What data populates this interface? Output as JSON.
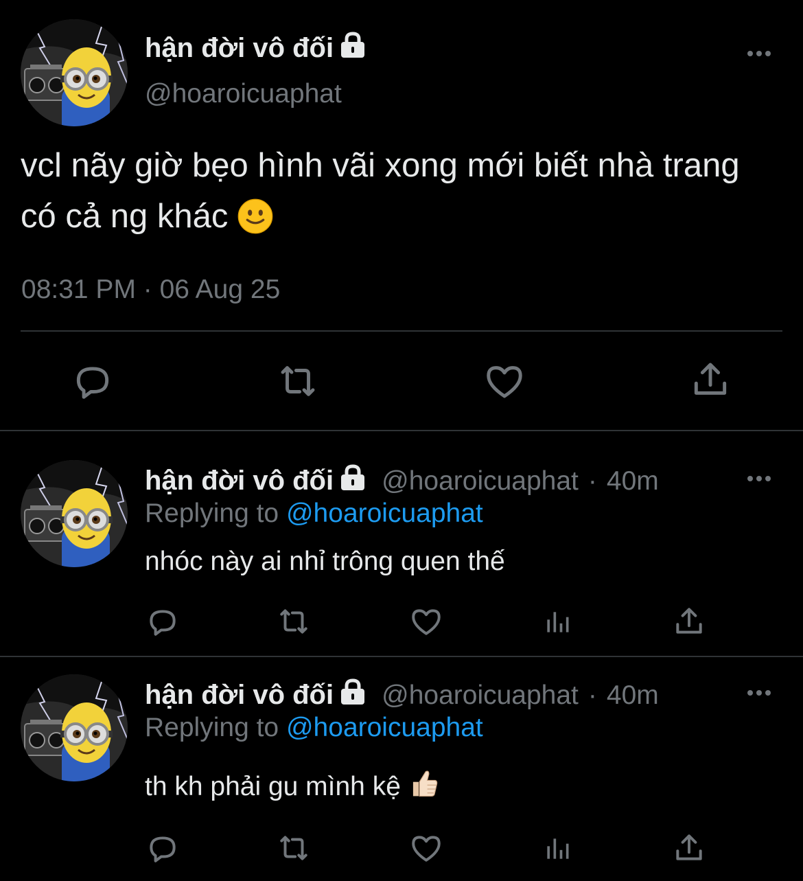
{
  "tweet": {
    "display_name": "hận đời vô đối",
    "handle": "@hoaroicuaphat",
    "text": "vcl nãy giờ bẹo hình vãi xong mới biết nhà trang có cả ng khác",
    "emoji": "🙂",
    "timestamp": "08:31 PM · 06 Aug 25",
    "actions": [
      "reply-icon",
      "retweet-icon",
      "like-icon",
      "share-icon"
    ]
  },
  "replies": [
    {
      "display_name": "hận đời vô đối",
      "handle": "@hoaroicuaphat",
      "separator": "·",
      "time": "40m",
      "replying_label": "Replying to",
      "replying_to": "@hoaroicuaphat",
      "text": "nhóc này ai nhỉ trông quen thế"
    },
    {
      "display_name": "hận đời vô đối",
      "handle": "@hoaroicuaphat",
      "separator": "·",
      "time": "40m",
      "replying_label": "Replying to",
      "replying_to": "@hoaroicuaphat",
      "text": "th kh phải gu mình kệ",
      "emoji": "👍🏻"
    }
  ],
  "colors": {
    "background": "#000000",
    "text": "#e7e9ea",
    "secondary": "#71767b",
    "link": "#1d9bf0",
    "divider": "#2f3336"
  }
}
